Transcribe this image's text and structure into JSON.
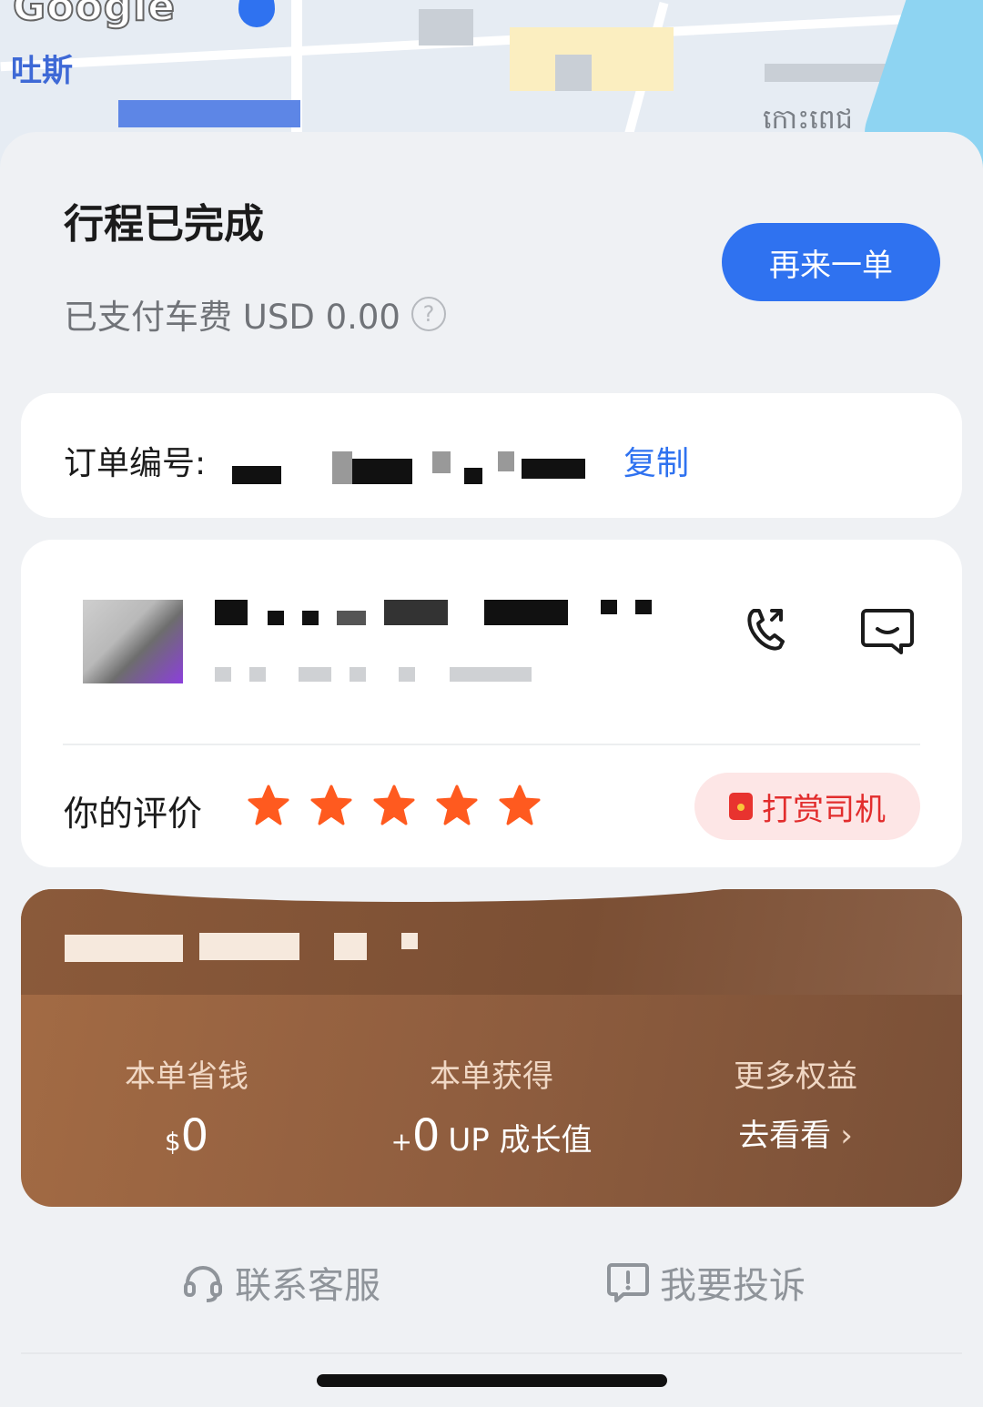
{
  "map": {
    "logo_text": "Google",
    "label_left": "吐斯",
    "label_right": "កោះពេជ"
  },
  "trip": {
    "status_title": "行程已完成",
    "fare_text": "已支付车费 USD 0.00",
    "help_icon": "?",
    "again_button": "再来一单"
  },
  "order": {
    "label": "订单编号:",
    "number_hidden": true,
    "copy_label": "复制"
  },
  "driver": {
    "name_hidden": true,
    "phone_icon": "phone-icon",
    "chat_icon": "chat-icon",
    "rating_label": "你的评价",
    "stars": 5,
    "tip_button": "打赏司机"
  },
  "member": {
    "saved_label": "本单省钱",
    "saved_currency": "$",
    "saved_value": "0",
    "earned_label": "本单获得",
    "earned_prefix": "+",
    "earned_value": "0",
    "earned_unit": "UP 成长值",
    "more_label": "更多权益",
    "more_link": "去看看"
  },
  "footer": {
    "service_label": "联系客服",
    "complaint_label": "我要投诉"
  },
  "colors": {
    "accent": "#2f72f0",
    "star": "#ff5a1f",
    "tip": "#e22d2d"
  }
}
